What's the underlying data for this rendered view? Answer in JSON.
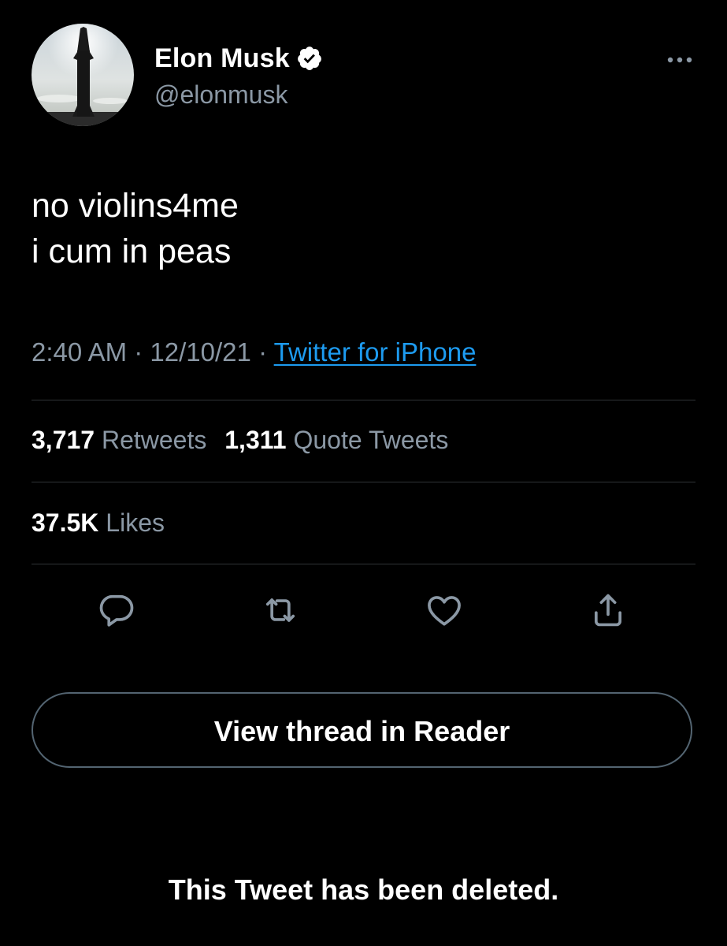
{
  "colors": {
    "background": "#000000",
    "text_primary": "#ffffff",
    "text_secondary": "#8b98a5",
    "link": "#1d9bf0",
    "divider": "#2f3336",
    "button_border": "#536471"
  },
  "author": {
    "display_name": "Elon Musk",
    "handle": "@elonmusk",
    "verified_icon": "verified-badge-icon",
    "avatar": "starship-rocket-avatar"
  },
  "tweet": {
    "lines": [
      "no violins4me",
      "i cum in peas"
    ],
    "time": "2:40 AM",
    "date": "12/10/21",
    "separator": "·",
    "source": "Twitter for iPhone"
  },
  "stats": {
    "retweets_count": "3,717",
    "retweets_label": "Retweets",
    "quotes_count": "1,311",
    "quotes_label": "Quote Tweets",
    "likes_count": "37.5K",
    "likes_label": "Likes"
  },
  "actions": [
    {
      "icon": "reply-icon"
    },
    {
      "icon": "retweet-icon"
    },
    {
      "icon": "like-heart-icon"
    },
    {
      "icon": "share-icon"
    }
  ],
  "reader_button_label": "View thread in Reader",
  "deleted_notice": "This Tweet has been deleted."
}
